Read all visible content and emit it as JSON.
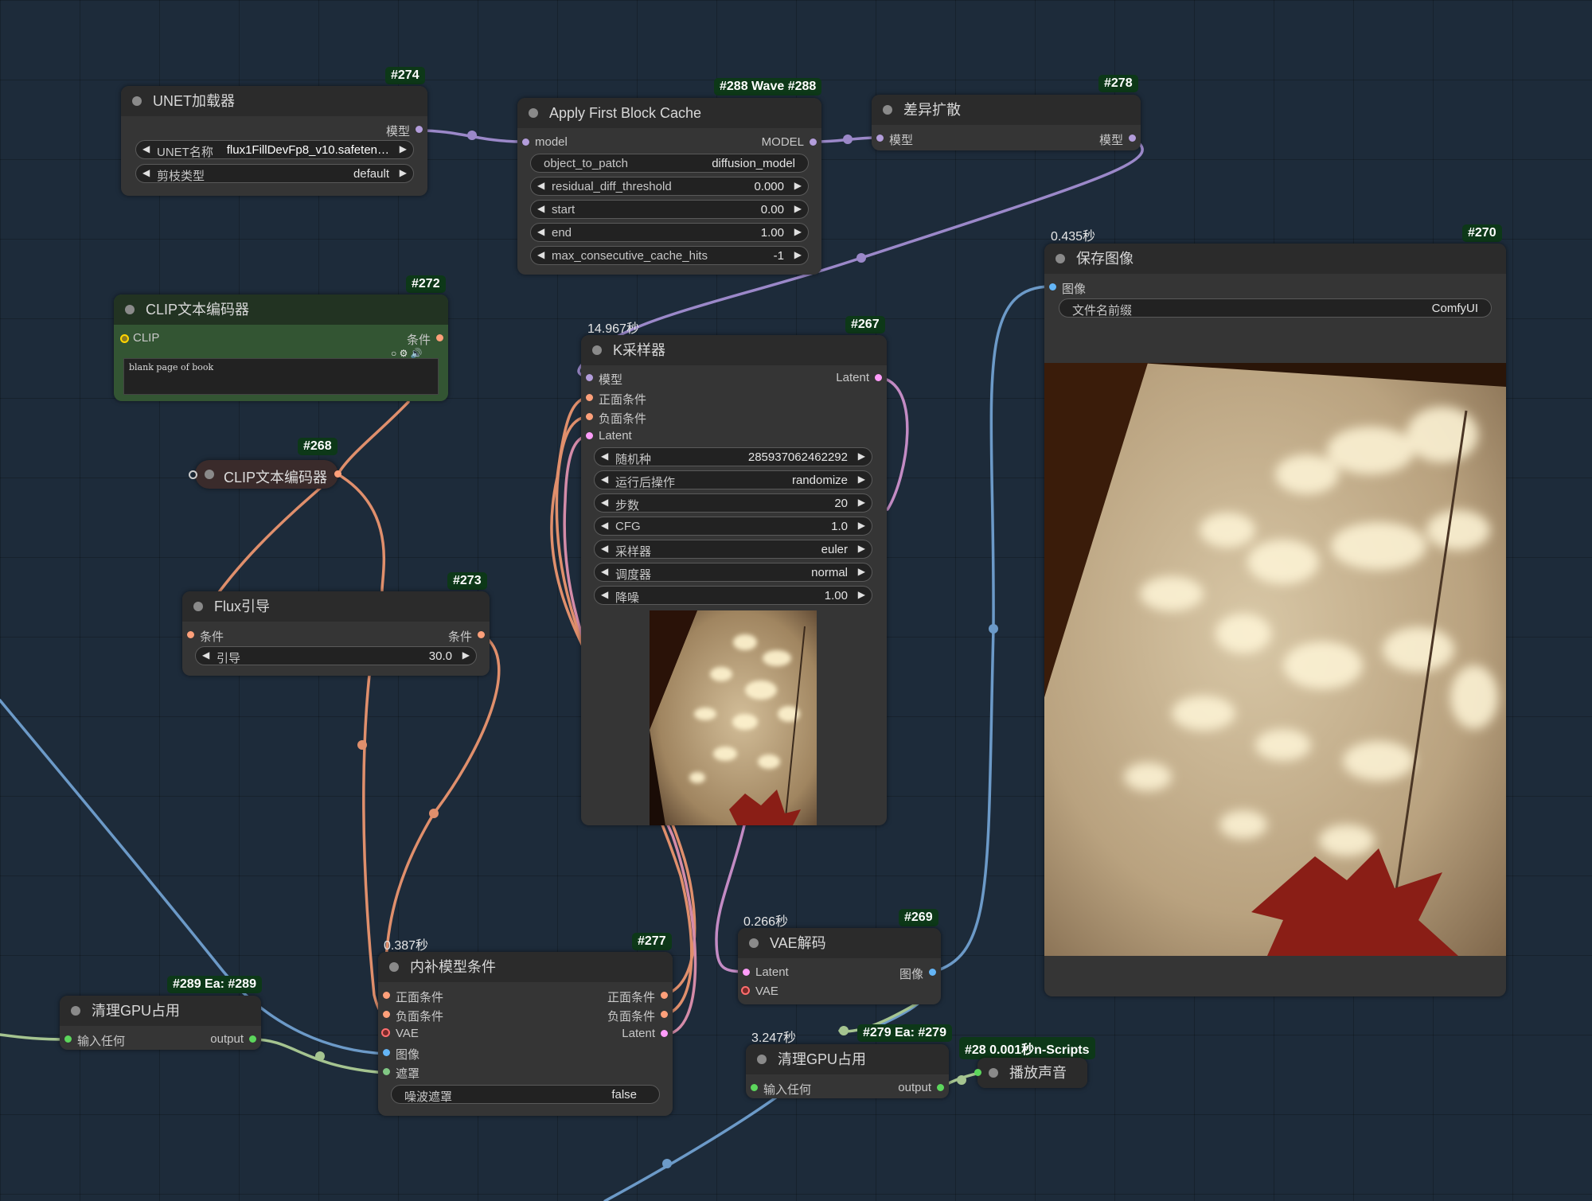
{
  "nodes": {
    "unet": {
      "title": "UNET加载器",
      "badge": "#274",
      "out_model": "模型",
      "w_name_label": "UNET名称",
      "w_name_value": "flux1FillDevFp8_v10.safeten…",
      "w_type_label": "剪枝类型",
      "w_type_value": "default"
    },
    "fbc": {
      "title": "Apply First Block Cache",
      "badge": "#288 Wave #288",
      "in_model": "model",
      "out_model": "MODEL",
      "w1_label": "object_to_patch",
      "w1_value": "diffusion_model",
      "w2_label": "residual_diff_threshold",
      "w2_value": "0.000",
      "w3_label": "start",
      "w3_value": "0.00",
      "w4_label": "end",
      "w4_value": "1.00",
      "w5_label": "max_consecutive_cache_hits",
      "w5_value": "-1"
    },
    "diff": {
      "title": "差异扩散",
      "badge": "#278",
      "in_model": "模型",
      "out_model": "模型"
    },
    "save": {
      "title": "保存图像",
      "badge": "#270",
      "time": "0.435秒",
      "in_image": "图像",
      "w_prefix_label": "文件名前缀",
      "w_prefix_value": "ComfyUI"
    },
    "clip1": {
      "title": "CLIP文本编码器",
      "badge": "#272",
      "in_clip": "CLIP",
      "out_cond": "条件",
      "text": "blank page of book"
    },
    "clip2": {
      "title": "CLIP文本编码器",
      "badge": "#268"
    },
    "ksampler": {
      "title": "K采样器",
      "badge": "#267",
      "time": "14.967秒",
      "in_model": "模型",
      "in_pos": "正面条件",
      "in_neg": "负面条件",
      "in_latent": "Latent",
      "out_latent": "Latent",
      "w_seed_label": "随机种",
      "w_seed_value": "285937062462292",
      "w_after_label": "运行后操作",
      "w_after_value": "randomize",
      "w_steps_label": "步数",
      "w_steps_value": "20",
      "w_cfg_label": "CFG",
      "w_cfg_value": "1.0",
      "w_sampler_label": "采样器",
      "w_sampler_value": "euler",
      "w_sched_label": "调度器",
      "w_sched_value": "normal",
      "w_denoise_label": "降噪",
      "w_denoise_value": "1.00"
    },
    "flux": {
      "title": "Flux引导",
      "badge": "#273",
      "in_cond": "条件",
      "out_cond": "条件",
      "w_guide_label": "引导",
      "w_guide_value": "30.0"
    },
    "inpaint": {
      "title": "内补模型条件",
      "badge": "#277",
      "time": "0.387秒",
      "in_pos": "正面条件",
      "in_neg": "负面条件",
      "in_vae": "VAE",
      "in_image": "图像",
      "in_mask": "遮罩",
      "out_pos": "正面条件",
      "out_neg": "负面条件",
      "out_latent": "Latent",
      "w_noise_label": "噪波遮罩",
      "w_noise_value": "false"
    },
    "vaedec": {
      "title": "VAE解码",
      "badge": "#269",
      "time": "0.266秒",
      "in_latent": "Latent",
      "in_vae": "VAE",
      "out_image": "图像"
    },
    "gpu1": {
      "title": "清理GPU占用",
      "badge": "#289 Ea: #289",
      "in_any": "输入任何",
      "out": "output"
    },
    "gpu2": {
      "title": "清理GPU占用",
      "badge": "#279 Ea: #279",
      "time": "3.247秒",
      "in_any": "输入任何",
      "out": "output"
    },
    "sound": {
      "title": "播放声音",
      "badge": "#28 0.001秒n-Scripts"
    }
  },
  "colors": {
    "model": "#b39ddb",
    "conditioning": "#ffa07a",
    "latent": "#ff9cf9",
    "vae": "#ff6e6e",
    "image": "#64b5f6",
    "mask": "#81c784",
    "any": "#5cd65c",
    "badge_bg": "#0d3818"
  }
}
